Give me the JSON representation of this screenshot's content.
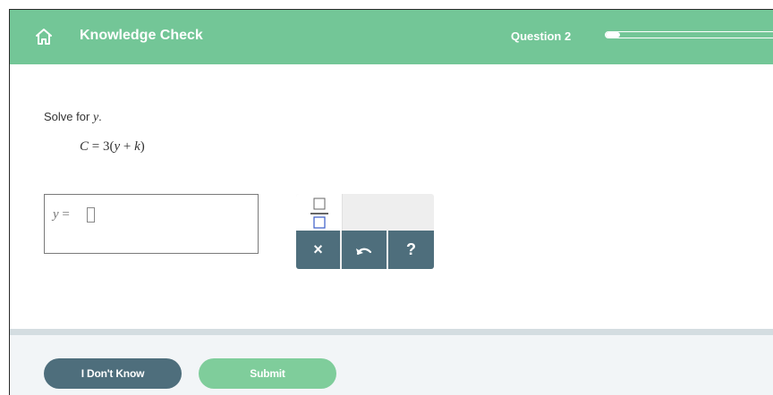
{
  "header": {
    "title": "Knowledge Check",
    "question_label": "Question 2",
    "progress_fraction": 0.08,
    "home_icon": "home-icon"
  },
  "question": {
    "prompt_text": "Solve for",
    "prompt_var": "y",
    "prompt_end": ".",
    "equation": {
      "lhs": "C",
      "eq": " = 3(",
      "var1": "y",
      "plus": " + ",
      "var2": "k",
      "close": ")"
    }
  },
  "answer": {
    "lhs_var": "y",
    "lhs_eq": " = "
  },
  "keypad": {
    "fraction_icon": "fraction-template-icon",
    "clear_label": "×",
    "undo_icon": "undo-icon",
    "help_label": "?"
  },
  "footer": {
    "dont_know_label": "I Don't Know",
    "submit_label": "Submit"
  },
  "colors": {
    "header": "#73c697",
    "key": "#4e6e7c",
    "submit": "#7fcd9b",
    "footer_bg": "#f2f5f7"
  }
}
